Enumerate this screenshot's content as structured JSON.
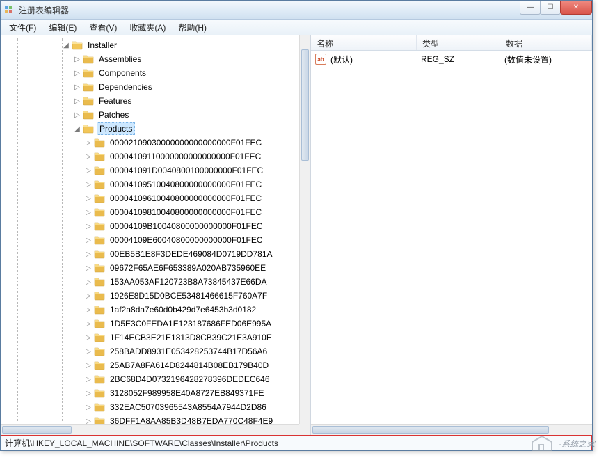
{
  "window_title": "注册表编辑器",
  "menu": [
    "文件(F)",
    "编辑(E)",
    "查看(V)",
    "收藏夹(A)",
    "帮助(H)"
  ],
  "tree": {
    "root_label": "Installer",
    "branches": [
      {
        "label": "Assemblies",
        "expander": "▷"
      },
      {
        "label": "Components",
        "expander": "▷"
      },
      {
        "label": "Dependencies",
        "expander": "▷"
      },
      {
        "label": "Features",
        "expander": "▷"
      },
      {
        "label": "Patches",
        "expander": "▷"
      }
    ],
    "selected_label": "Products",
    "products": [
      "00002109030000000000000000F01FEC",
      "00004109110000000000000000F01FEC",
      "000041091D0040800100000000F01FEC",
      "00004109510040800000000000F01FEC",
      "00004109610040800000000000F01FEC",
      "00004109810040800000000000F01FEC",
      "00004109B10040800000000000F01FEC",
      "00004109E60040800000000000F01FEC",
      "00EB5B1E8F3DEDE469084D0719DD781A",
      "09672F65AE6F653389A020AB735960EE",
      "153AA053AF120723B8A73845437E66DA",
      "1926E8D15D0BCE53481466615F760A7F",
      "1af2a8da7e60d0b429d7e6453b3d0182",
      "1D5E3C0FEDA1E123187686FED06E995A",
      "1F14ECB3E21E1813D8CB39C21E3A910E",
      "258BADD8931E053428253744B17D56A6",
      "25AB7A8FA614D8244814B08EB179B40D",
      "2BC68D4D0732196428278396DEDEC646",
      "3128052F989958E40A8727EB849371FE",
      "332EAC50703965543A8554A7944D2D86",
      "36DFF1A8AA85B3D48B7EDA770C48F4E9"
    ]
  },
  "list": {
    "headers": {
      "name": "名称",
      "type": "类型",
      "data": "数据"
    },
    "rows": [
      {
        "icon": "ab",
        "name": "(默认)",
        "type": "REG_SZ",
        "data": "(数值未设置)"
      }
    ]
  },
  "status_path": "计算机\\HKEY_LOCAL_MACHINE\\SOFTWARE\\Classes\\Installer\\Products",
  "watermark_text": "·系统之家"
}
